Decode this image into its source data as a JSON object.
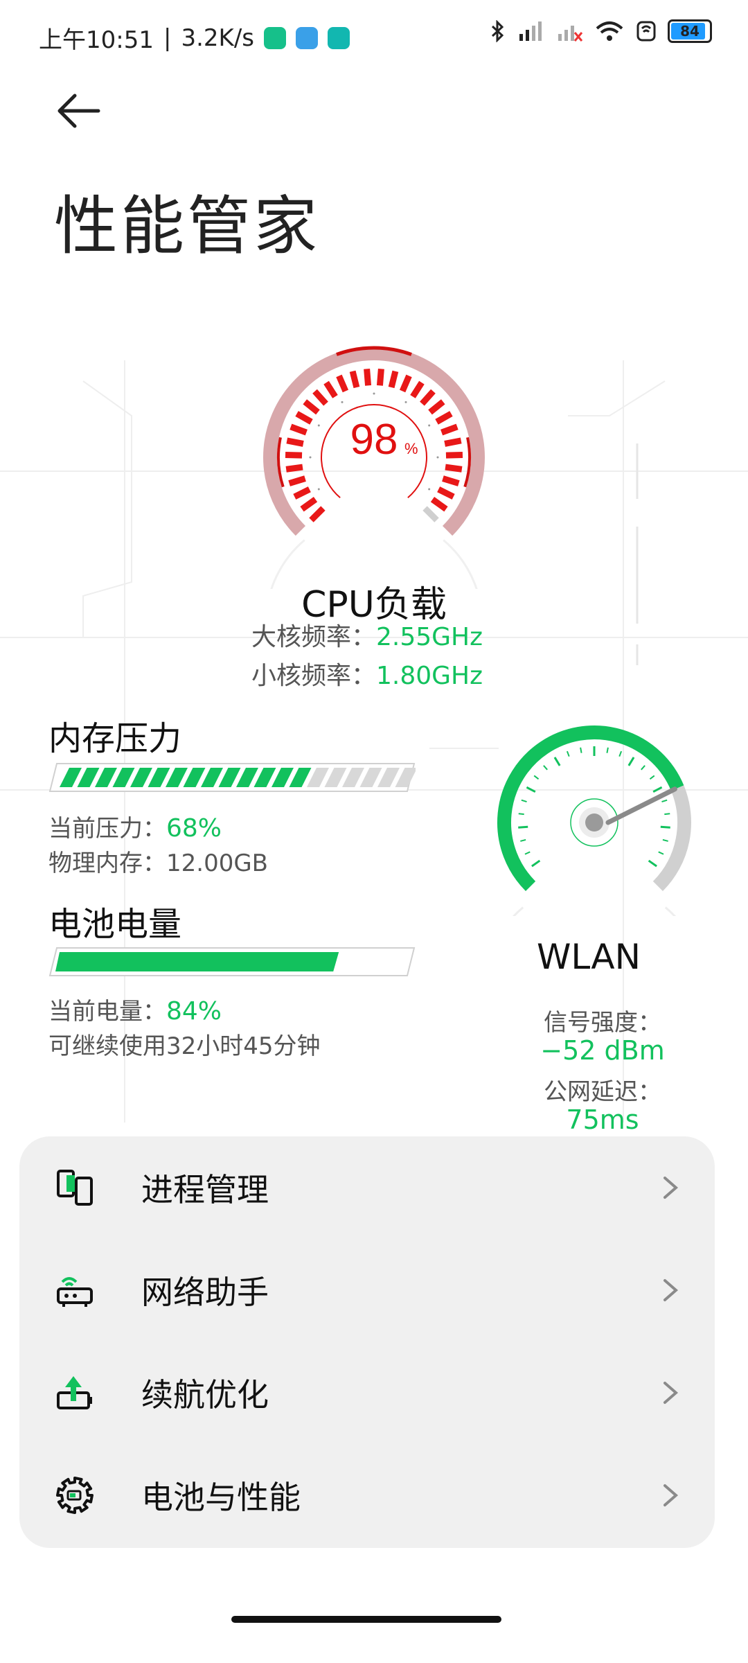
{
  "status_bar": {
    "time": "上午10:51",
    "speed": "3.2K/s",
    "battery": "84",
    "battery_level": 0.84,
    "app_icons": [
      "shield-app-icon",
      "book-app-icon",
      "running-app-icon"
    ],
    "right_icons": [
      "bluetooth-icon",
      "signal-hd-icon",
      "signal-no-sim-icon",
      "wifi-icon",
      "nfc-icon"
    ]
  },
  "page": {
    "title": "性能管家"
  },
  "cpu": {
    "percent": "98",
    "percent_unit": "%",
    "load_value": 98,
    "title": "CPU负载",
    "big_core_label": "大核频率：",
    "big_core_value": "2.55GHz",
    "small_core_label": "小核频率：",
    "small_core_value": "1.80GHz",
    "color": "#e01010"
  },
  "memory": {
    "title": "内存压力",
    "pressure_label": "当前压力：",
    "pressure_value": "68%",
    "pressure_level": 0.68,
    "physical_label": "物理内存：",
    "physical_value": "12.00GB"
  },
  "battery": {
    "title": "电池电量",
    "level_label": "当前电量：",
    "level_value": "84%",
    "level": 0.84,
    "remaining": "可继续使用32小时45分钟"
  },
  "wlan": {
    "title": "WLAN",
    "signal_label": "信号强度：",
    "signal_value": "−52 dBm",
    "latency_label": "公网延迟：",
    "latency_value": "75ms",
    "gauge_level": 0.75
  },
  "menu": [
    {
      "label": "进程管理",
      "icon": "process-icon"
    },
    {
      "label": "网络助手",
      "icon": "router-icon"
    },
    {
      "label": "续航优化",
      "icon": "battery-boost-icon"
    },
    {
      "label": "电池与性能",
      "icon": "gear-icon"
    }
  ],
  "colors": {
    "green": "#12c15d",
    "red": "#e01010",
    "card": "#f0f0f0"
  }
}
